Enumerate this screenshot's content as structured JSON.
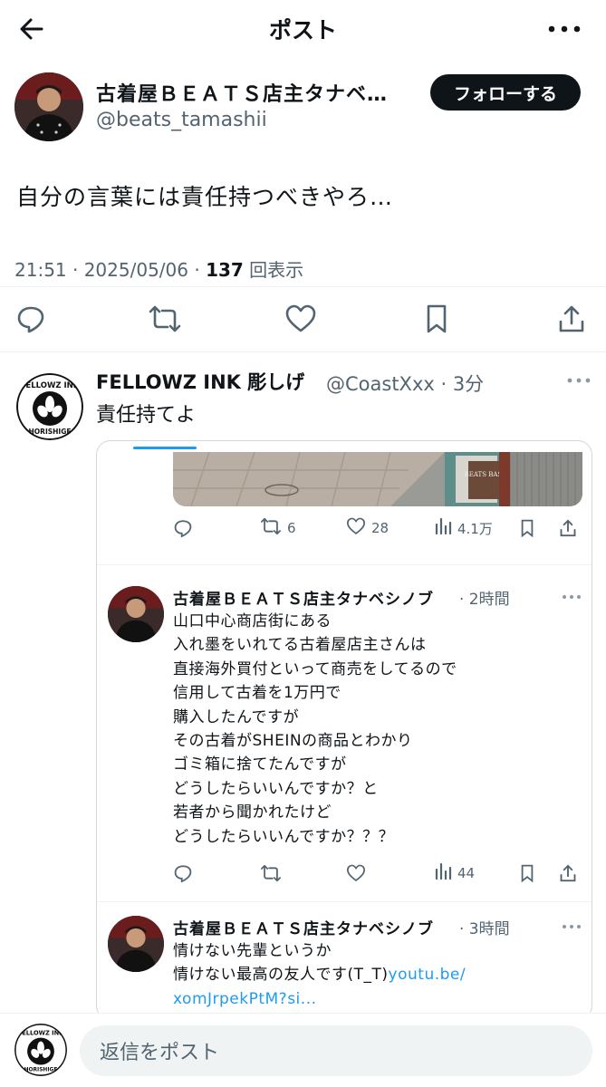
{
  "header": {
    "title": "ポスト",
    "back_icon": "arrow-left-icon",
    "more_icon": "more-horizontal-icon"
  },
  "post": {
    "author_name": "古着屋ＢＥＡＴＳ店主タナベ…",
    "author_handle": "@beats_tamashii",
    "follow_label": "フォローする",
    "text": "自分の言葉には責任持つべきやろ…",
    "time_date": "21:51 · 2025/05/06 · ",
    "views_count": "137",
    "views_label": " 回表示",
    "actions": [
      "reply-icon",
      "retweet-icon",
      "like-icon",
      "bookmark-icon",
      "share-icon"
    ]
  },
  "reply": {
    "name": "FELLOWZ INK 彫しげ",
    "handle_time": "@CoastXxx · 3分",
    "text": "責任持てよ",
    "avatar_top": "FELLOWZ INK",
    "avatar_bottom": "HORISHIGE"
  },
  "quoted": {
    "photo_sign": "BEATS BASE",
    "row1": {
      "retweets": "6",
      "likes": "28",
      "views": "4.1万"
    },
    "tweet1": {
      "name": "古着屋ＢＥＡＴＳ店主タナベシノブ",
      "time": "· 2時間",
      "lines": [
        "山口中心商店街にある",
        "入れ墨をいれてる古着屋店主さんは",
        "直接海外買付といって商売をしてるので",
        "信用して古着を1万円で",
        "購入したんですが",
        "その古着がSHEINの商品とわかり",
        "ゴミ箱に捨てたんですが",
        "どうしたらいいんですか？と",
        "若者から聞かれたけど",
        "どうしたらいいんですか？？？"
      ],
      "views": "44"
    },
    "tweet2": {
      "name": "古着屋ＢＥＡＴＳ店主タナベシノブ",
      "time": "· 3時間",
      "line1": "情けない先輩というか",
      "line2_text": "情けない最高の友人です(T_T)",
      "line2_link": "youtu.be/",
      "line3_link": "xomJrpekPtM?si..."
    }
  },
  "bottom": {
    "placeholder": "返信をポスト"
  },
  "colors": {
    "accent": "#1d9bf0",
    "text": "#0f1419",
    "muted": "#536471",
    "border": "#cfd9de"
  }
}
